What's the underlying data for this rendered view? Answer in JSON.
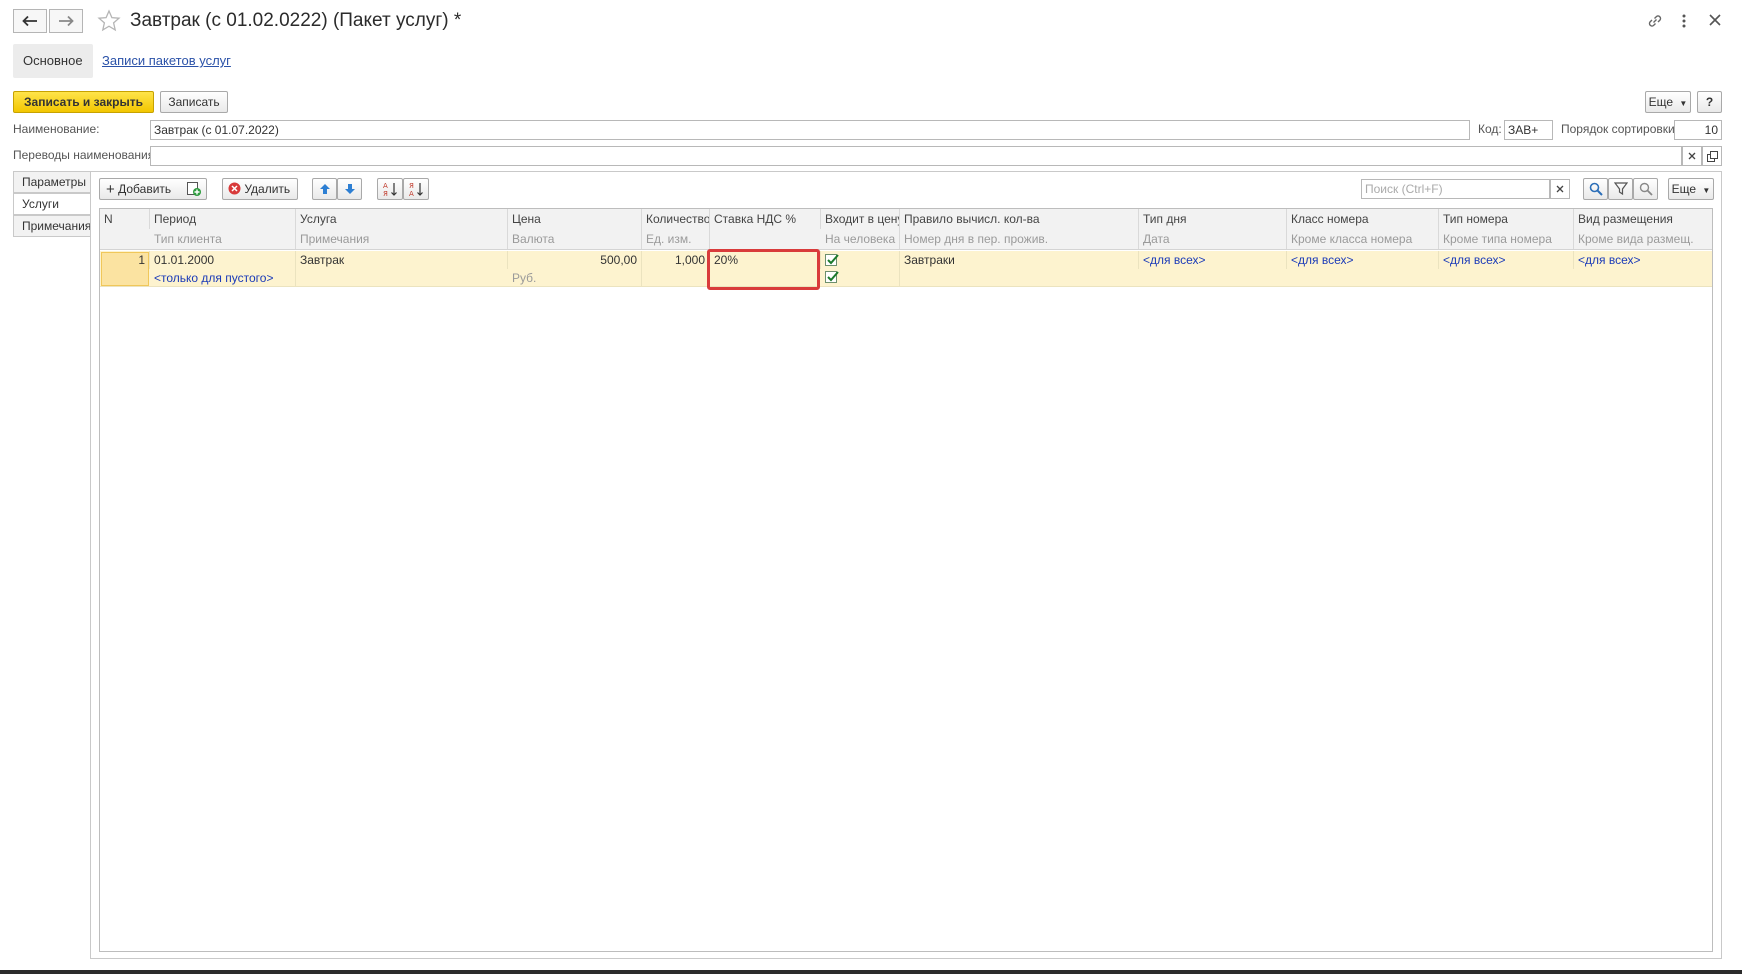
{
  "window": {
    "title": "Завтрак (с 01.02.0222) (Пакет услуг) *"
  },
  "top_tabs": {
    "main": "Основное",
    "records_link": "Записи пакетов услуг"
  },
  "toolbar": {
    "save_close": "Записать и закрыть",
    "save": "Записать",
    "more": "Еще",
    "help": "?"
  },
  "form": {
    "name_label": "Наименование:",
    "name_value": "Завтрак (с 01.07.2022)",
    "code_label": "Код:",
    "code_value": "ЗАВ+",
    "sort_label": "Порядок сортировки:",
    "sort_value": "10",
    "translations_label": "Переводы наименования:",
    "translations_value": ""
  },
  "side_tabs": [
    "Параметры",
    "Услуги",
    "Примечания"
  ],
  "table_toolbar": {
    "add": "Добавить",
    "delete": "Удалить",
    "search_placeholder": "Поиск (Ctrl+F)",
    "more": "Еще"
  },
  "columns_top": [
    "N",
    "Период",
    "Услуга",
    "Цена",
    "Количество",
    "Ставка НДС %",
    "Входит в цену",
    "Правило вычисл. кол-ва",
    "Тип дня",
    "Класс номера",
    "Тип номера",
    "Вид размещения"
  ],
  "columns_bottom": [
    "",
    "Тип клиента",
    "Примечания",
    "Валюта",
    "Ед. изм.",
    "",
    "На человека",
    "Номер дня в пер. прожив.",
    "Дата",
    "Кроме класса номера",
    "Кроме типа номера",
    "Кроме вида размещ."
  ],
  "rows": [
    {
      "n": "1",
      "period": "01.01.2000",
      "client_type": "<только для пустого>",
      "service": "Завтрак",
      "notes": "",
      "price": "500,00",
      "currency": "Руб.",
      "quantity": "1,000",
      "unit": "",
      "vat": "20%",
      "included_in_price": true,
      "per_person": true,
      "rule": "Завтраки",
      "day_type": "<для всех>",
      "room_class": "<для всех>",
      "room_type": "<для всех>",
      "accommodation": "<для всех>"
    }
  ],
  "colors": {
    "accent_yellow": "#f2c600",
    "row_highlight": "#fdf3cf",
    "highlight_box": "#d93b3b",
    "link": "#1a3ab8"
  }
}
